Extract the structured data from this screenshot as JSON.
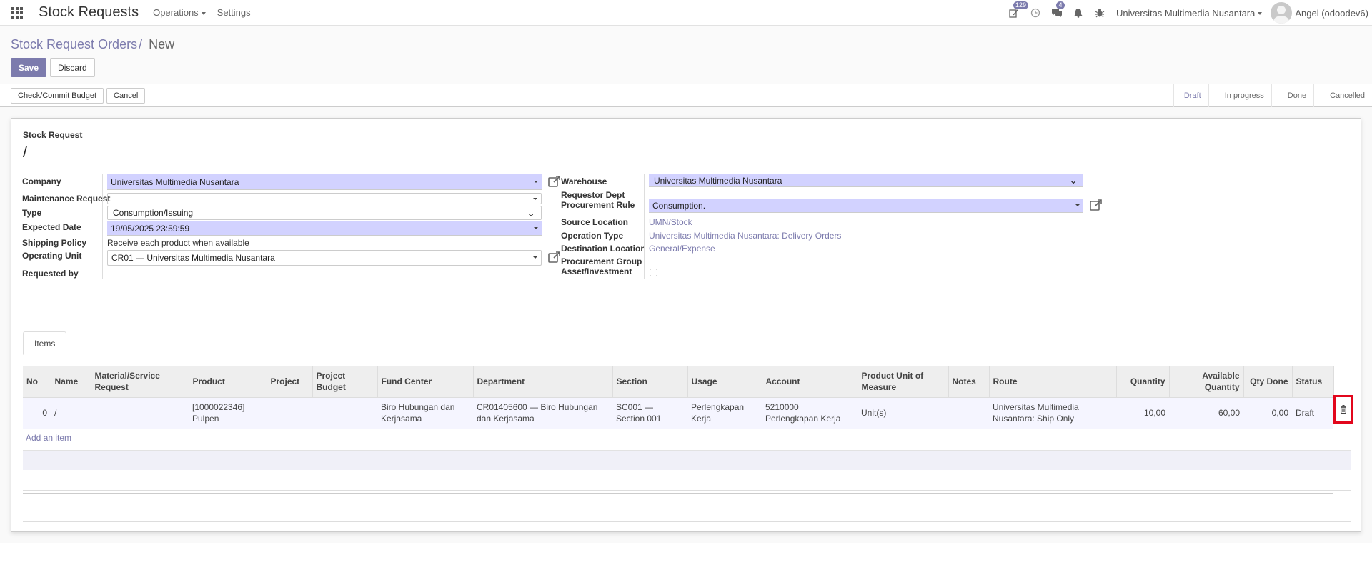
{
  "topbar": {
    "brand": "Stock Requests",
    "menus": [
      {
        "label": "Operations",
        "dropdown": true
      },
      {
        "label": "Settings",
        "dropdown": false
      }
    ],
    "systray": {
      "activity_badge": "129",
      "messages_badge": "4",
      "company": "Universitas Multimedia Nusantara",
      "user": "Angel (odoodev6)"
    }
  },
  "control_panel": {
    "breadcrumb_parent": "Stock Request Orders",
    "breadcrumb_sep": "/",
    "breadcrumb_current": "New",
    "save_label": "Save",
    "discard_label": "Discard"
  },
  "statusbar": {
    "check_budget_label": "Check/Commit Budget",
    "cancel_label": "Cancel",
    "stages": [
      "Draft",
      "In progress",
      "Done",
      "Cancelled"
    ],
    "active_stage": "Draft"
  },
  "form": {
    "record_label": "Stock Request",
    "record_name": "/",
    "left": {
      "company_label": "Company",
      "company_value": "Universitas Multimedia Nusantara",
      "maintenance_label": "Maintenance Request",
      "maintenance_value": "",
      "type_label": "Type",
      "type_value": "Consumption/Issuing",
      "expected_date_label": "Expected Date",
      "expected_date_value": "19/05/2025 23:59:59",
      "shipping_policy_label": "Shipping Policy",
      "shipping_policy_value": "Receive each product when available",
      "operating_unit_label": "Operating Unit",
      "operating_unit_value": "CR01 — Universitas Multimedia Nusantara",
      "requested_by_label": "Requested by"
    },
    "right": {
      "warehouse_label": "Warehouse",
      "warehouse_value": "Universitas Multimedia Nusantara",
      "requestor_dept_label": "Requestor Dept",
      "procurement_rule_label": "Procurement Rule",
      "procurement_rule_value": "Consumption.",
      "source_location_label": "Source Location",
      "source_location_value": "UMN/Stock",
      "operation_type_label": "Operation Type",
      "operation_type_value": "Universitas Multimedia Nusantara: Delivery Orders",
      "destination_label": "Destination Location",
      "destination_value": "General/Expense",
      "procurement_group_label": "Procurement Group",
      "asset_label": "Asset/Investment"
    }
  },
  "tabs": [
    "Items"
  ],
  "items_table": {
    "columns": [
      "No",
      "Name",
      "Material/Service Request",
      "Product",
      "Project",
      "Project Budget",
      "Fund Center",
      "Department",
      "Section",
      "Usage",
      "Account",
      "Product Unit of Measure",
      "Notes",
      "Route",
      "Quantity",
      "Available Quantity",
      "Qty Done",
      "Status"
    ],
    "rows": [
      {
        "no": "0",
        "name": "/",
        "material_request": "",
        "product": "[1000022346] Pulpen",
        "project": "",
        "project_budget": "",
        "fund_center": "Biro Hubungan dan Kerjasama",
        "department": "CR01405600 — Biro Hubungan dan Kerjasama",
        "section": "SC001 — Section 001",
        "usage": "Perlengkapan Kerja",
        "account": "5210000 Perlengkapan Kerja",
        "uom": "Unit(s)",
        "notes": "",
        "route": "Universitas Multimedia Nusantara: Ship Only",
        "quantity": "10,00",
        "available_quantity": "60,00",
        "qty_done": "0,00",
        "status": "Draft"
      }
    ],
    "add_item_label": "Add an item"
  },
  "colors": {
    "accent": "#7c7bad",
    "required_field": "#d2d2ff",
    "highlight_box": "#e2061c"
  }
}
